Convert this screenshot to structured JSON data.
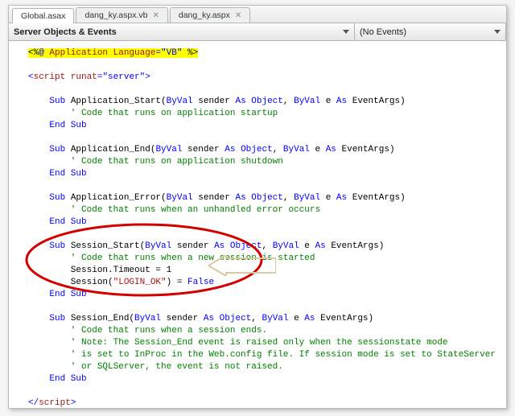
{
  "tabs": {
    "t0": "Global.asax",
    "t1": "dang_ky.aspx.vb",
    "t2": "dang_ky.aspx"
  },
  "dropdowns": {
    "left": "Server Objects & Events",
    "right": "(No Events)"
  },
  "code": {
    "l01a": "<%",
    "l01b": "@ ",
    "l01c": "Application ",
    "l01d": "Language",
    "l01e": "=",
    "l01f": "\"VB\" ",
    "l01g": "%>",
    "l03a": "<",
    "l03b": "script ",
    "l03c": "runat",
    "l03d": "=",
    "l03e": "\"server\"",
    "l03f": ">",
    "l05a": "    Sub ",
    "l05b": "Application_Start(",
    "l05c": "ByVal ",
    "l05d": "sender ",
    "l05e": "As ",
    "l05f": "Object",
    "l05g": ", ",
    "l05h": "ByVal ",
    "l05i": "e ",
    "l05j": "As ",
    "l05k": "EventArgs",
    "l05l": ")",
    "l06": "        ' Code that runs on application startup",
    "l07": "    End Sub",
    "l09a": "    Sub ",
    "l09b": "Application_End(",
    "l09c": "ByVal ",
    "l09d": "sender ",
    "l09e": "As ",
    "l09f": "Object",
    "l09g": ", ",
    "l09h": "ByVal ",
    "l09i": "e ",
    "l09j": "As ",
    "l09k": "EventArgs",
    "l09l": ")",
    "l10": "        ' Code that runs on application shutdown",
    "l11": "    End Sub",
    "l13a": "    Sub ",
    "l13b": "Application_Error(",
    "l13c": "ByVal ",
    "l13d": "sender ",
    "l13e": "As ",
    "l13f": "Object",
    "l13g": ", ",
    "l13h": "ByVal ",
    "l13i": "e ",
    "l13j": "As ",
    "l13k": "EventArgs",
    "l13l": ")",
    "l14": "        ' Code that runs when an unhandled error occurs",
    "l15": "    End Sub",
    "l17a": "    Sub ",
    "l17b": "Session_Start(",
    "l17c": "ByVal ",
    "l17d": "sender ",
    "l17e": "As ",
    "l17f": "Object",
    "l17g": ", ",
    "l17h": "ByVal ",
    "l17i": "e ",
    "l17j": "As ",
    "l17k": "EventArgs",
    "l17l": ")",
    "l18": "        ' Code that runs when a new session is started",
    "l19a": "        Session.Timeout = 1",
    "l20a": "        Session(",
    "l20b": "\"LOGIN_OK\"",
    "l20c": ") = ",
    "l20d": "False",
    "l21": "    End Sub",
    "l23a": "    Sub ",
    "l23b": "Session_End(",
    "l23c": "ByVal ",
    "l23d": "sender ",
    "l23e": "As ",
    "l23f": "Object",
    "l23g": ", ",
    "l23h": "ByVal ",
    "l23i": "e ",
    "l23j": "As ",
    "l23k": "EventArgs",
    "l23l": ")",
    "l24": "        ' Code that runs when a session ends. ",
    "l25": "        ' Note: The Session_End event is raised only when the sessionstate mode",
    "l26": "        ' is set to InProc in the Web.config file. If session mode is set to StateServer ",
    "l27": "        ' or SQLServer, the event is not raised.",
    "l28": "    End Sub",
    "l30a": "</",
    "l30b": "script",
    "l30c": ">"
  }
}
